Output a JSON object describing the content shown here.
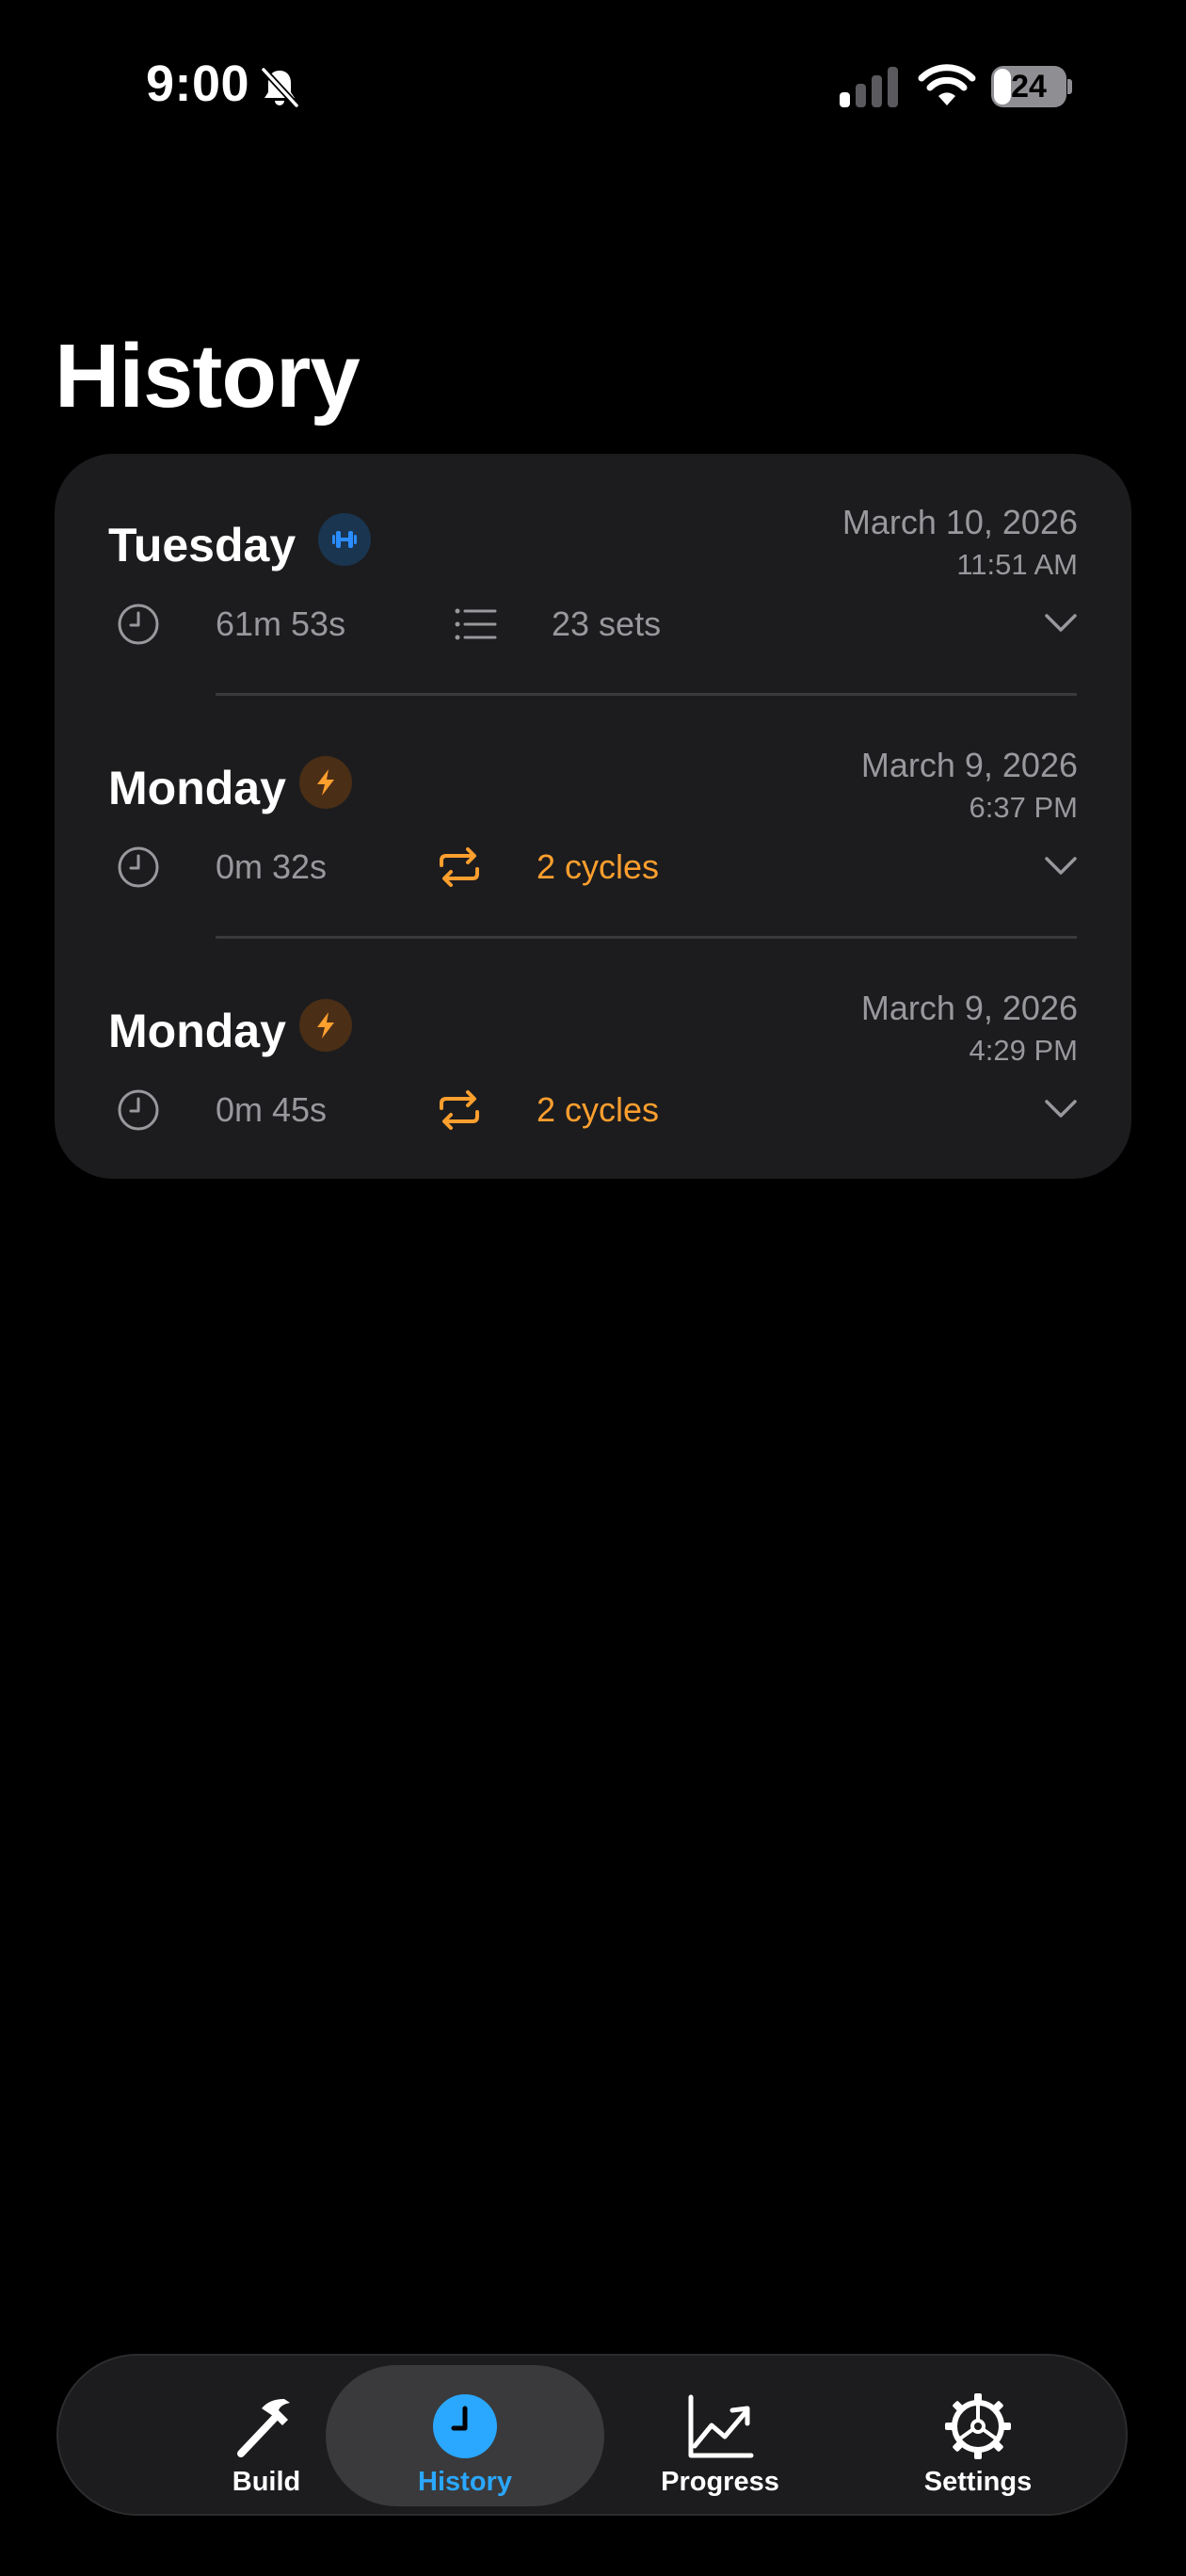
{
  "status_bar": {
    "time": "9:00",
    "battery_level": "24",
    "battery_fraction": 0.24,
    "icons": [
      "bell-slash-icon",
      "signal-icon",
      "wifi-icon",
      "battery-icon"
    ]
  },
  "page_title": "History",
  "colors": {
    "background": "#000000",
    "card": "#1c1c1e",
    "secondary_text": "#98989d",
    "accent_blue": "#2aa7ff",
    "accent_orange": "#ff9f2e",
    "strength_badge": "#1a3550",
    "interval_badge": "#4a2e16"
  },
  "history_entries": [
    {
      "day": "Tuesday",
      "badge_icon": "dumbbell-icon",
      "date": "March 10, 2026",
      "time": "11:51 AM",
      "duration": "61m 53s",
      "meta_icon": "list-icon",
      "meta_text": "23 sets"
    },
    {
      "day": "Monday",
      "badge_icon": "bolt-icon",
      "date": "March 9, 2026",
      "time": "6:37 PM",
      "duration": "0m 32s",
      "meta_icon": "repeat-icon",
      "meta_text": "2 cycles"
    },
    {
      "day": "Monday",
      "badge_icon": "bolt-icon",
      "date": "March 9, 2026",
      "time": "4:29 PM",
      "duration": "0m 45s",
      "meta_icon": "repeat-icon",
      "meta_text": "2 cycles"
    }
  ],
  "tab_bar": {
    "tabs": [
      {
        "label": "Build",
        "icon": "hammer-icon"
      },
      {
        "label": "History",
        "icon": "clock-icon",
        "active": true
      },
      {
        "label": "Progress",
        "icon": "chart-line-icon"
      },
      {
        "label": "Settings",
        "icon": "gear-icon"
      }
    ]
  }
}
